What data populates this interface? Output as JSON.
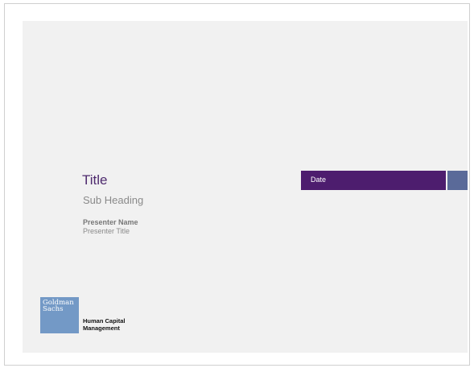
{
  "slide": {
    "title": "Title",
    "subheading": "Sub Heading",
    "presenter_name": "Presenter Name",
    "presenter_title": "Presenter Title",
    "date": "Date"
  },
  "logo": {
    "line1": "Goldman",
    "line2": "Sachs",
    "division_line1": "Human Capital",
    "division_line2": "Management"
  },
  "colors": {
    "title": "#4e2a6e",
    "date_bar": "#4d1d6e",
    "date_accent": "#5a6a99",
    "logo_box": "#7399c6",
    "slide_background": "#f1f1f1"
  }
}
